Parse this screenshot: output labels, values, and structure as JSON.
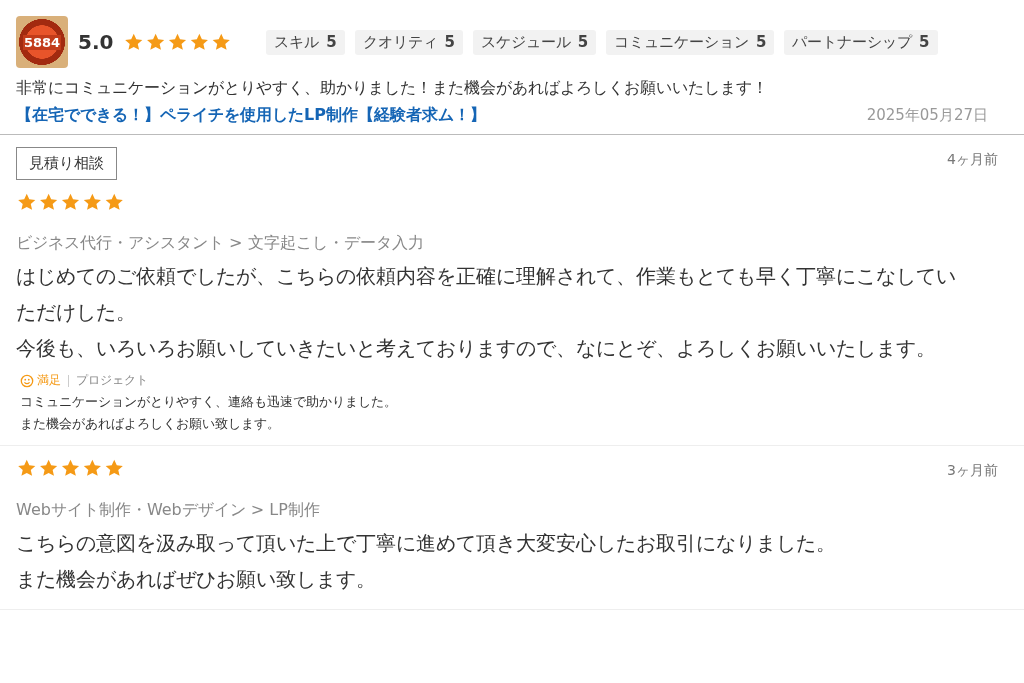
{
  "top_review": {
    "avatar_text": "5884",
    "score": "5.0",
    "stars": 5,
    "ratings": [
      {
        "label": "スキル",
        "value": "5"
      },
      {
        "label": "クオリティ",
        "value": "5"
      },
      {
        "label": "スケジュール",
        "value": "5"
      },
      {
        "label": "コミュニケーション",
        "value": "5"
      },
      {
        "label": "パートナーシップ",
        "value": "5"
      }
    ],
    "comment": "非常にコミュニケーションがとりやすく、助かりました！また機会があればよろしくお願いいたします！",
    "job_link": "【在宅でできる！】ペライチを使用したLP制作【経験者求ム！】",
    "date": "2025年05月27日"
  },
  "reviews": [
    {
      "tag": "見積り相談",
      "time": "4ヶ月前",
      "stars": 5,
      "category": "ビジネス代行・アシスタント > 文字起こし・データ入力",
      "paragraphs": [
        "はじめてのご依頼でしたが、こちらの依頼内容を正確に理解されて、作業もとても早く丁寧にこなしていただけした。",
        "今後も、いろいろお願いしていきたいと考えておりますので、なにとぞ、よろしくお願いいたします。"
      ],
      "reply": {
        "satisfaction": "満足",
        "type": "プロジェクト",
        "lines": [
          "コミュニケーションがとりやすく、連絡も迅速で助かりました。",
          "また機会があればよろしくお願い致します。"
        ]
      }
    },
    {
      "time": "3ヶ月前",
      "stars": 5,
      "category": "Webサイト制作・Webデザイン > LP制作",
      "paragraphs": [
        "こちらの意図を汲み取って頂いた上で丁寧に進めて頂き大変安心したお取引になりました。",
        "また機会があればぜひお願い致します。"
      ]
    }
  ]
}
